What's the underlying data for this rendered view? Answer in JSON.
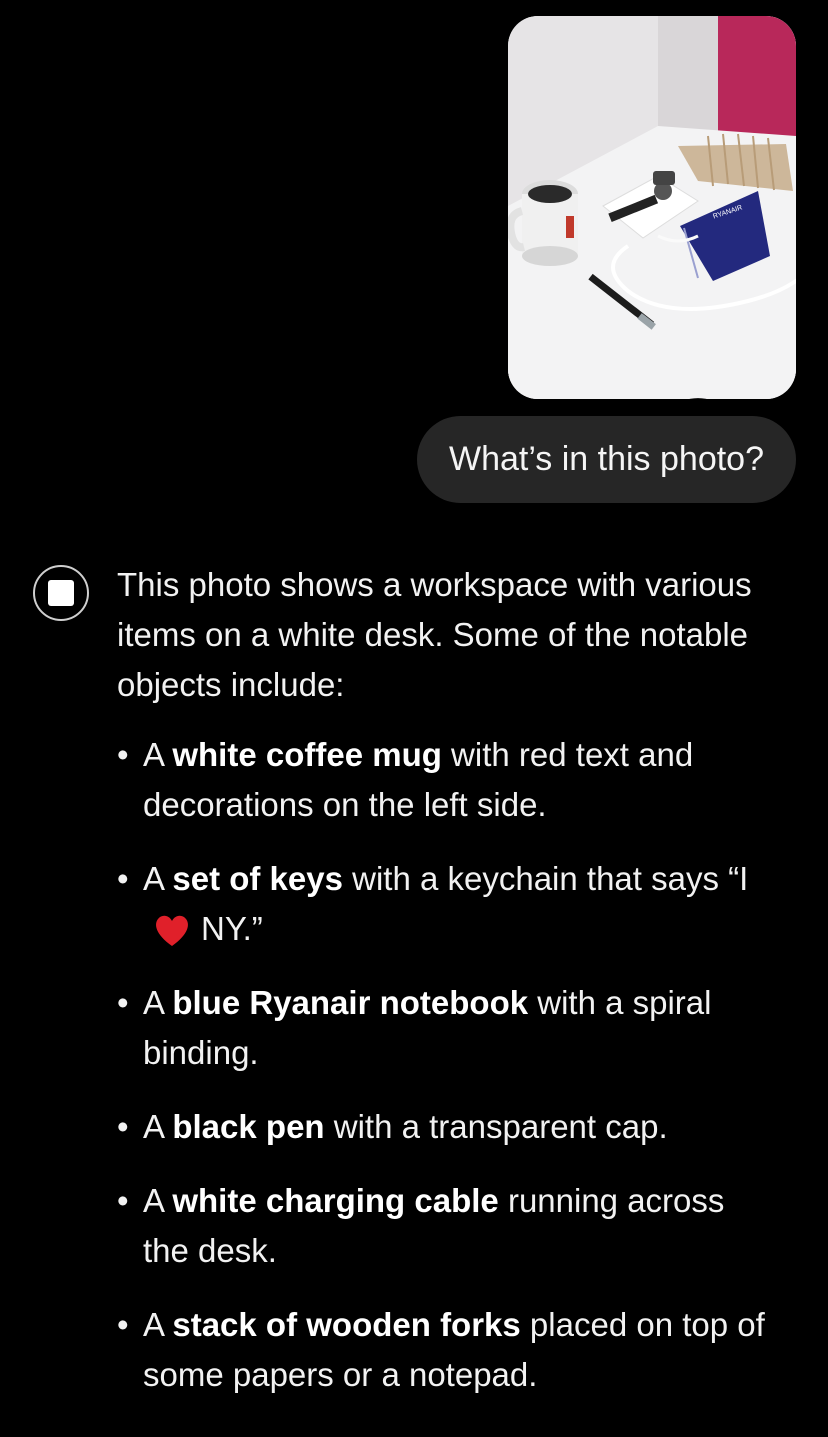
{
  "user_message": {
    "photo_alt": "Photo of a desk",
    "notebook_brand": "RYANAIR",
    "text": "What’s in this photo?"
  },
  "assistant": {
    "avatar_icon": "square-icon",
    "intro": "This photo shows a workspace with various items on a white desk. Some of the notable objects include:",
    "items": [
      {
        "pre": "A ",
        "bold": "white coffee mug",
        "post": " with red text and decorations on the left side."
      },
      {
        "pre": "A ",
        "bold": "set of keys",
        "post": " with a keychain that says “I",
        "emoji": "heart-icon",
        "post2": "NY.”"
      },
      {
        "pre": "A ",
        "bold": "blue Ryanair notebook",
        "post": " with a spiral binding."
      },
      {
        "pre": "A ",
        "bold": "black pen",
        "post": " with a transparent cap."
      },
      {
        "pre": "A ",
        "bold": "white charging cable",
        "post": " running across the desk."
      },
      {
        "pre": "A ",
        "bold": "stack of wooden forks",
        "post": " placed on top of some papers or a notepad."
      }
    ]
  },
  "colors": {
    "background": "#000000",
    "bubble": "#262626",
    "text": "#f2f2f2",
    "heart": "#e0202a",
    "notebook": "#2a2f8c"
  }
}
